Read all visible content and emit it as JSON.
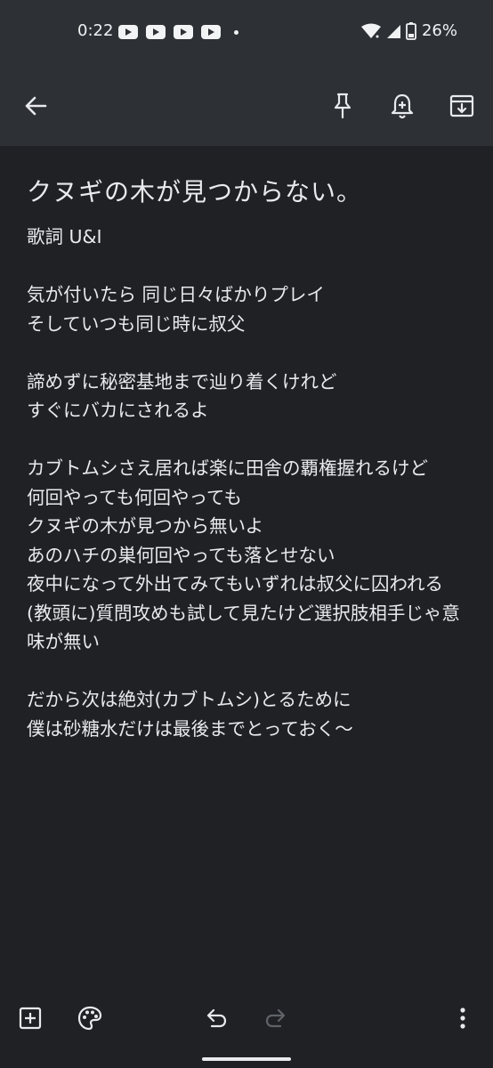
{
  "status_bar": {
    "time": "0:22",
    "battery": "26%",
    "app_icons": [
      "youtube-icon",
      "youtube-icon",
      "youtube-icon",
      "youtube-icon"
    ]
  },
  "toolbar": {
    "icons": [
      "back-arrow-icon",
      "pin-icon",
      "reminder-bell-icon",
      "archive-icon"
    ]
  },
  "note": {
    "title": "クヌギの木が見つからない。",
    "body": "歌詞 U&I\n\n気が付いたら 同じ日々ばかりプレイ\nそしていつも同じ時に叔父\n\n諦めずに秘密基地まで辿り着くけれど\nすぐにバカにされるよ\n\nカブトムシさえ居れば楽に田舎の覇権握れるけど\n何回やっても何回やっても\nクヌギの木が見つから無いよ\nあのハチの巣何回やっても落とせない\n夜中になって外出てみてもいずれは叔父に囚われる\n(教頭に)質問攻めも試して見たけど選択肢相手じゃ意味が無い\n\nだから次は絶対(カブトムシ)とるために\n僕は砂糖水だけは最後までとっておく〜"
  },
  "bottom_bar": {
    "icons": [
      "add-box-icon",
      "palette-icon",
      "undo-icon",
      "redo-icon",
      "more-vert-icon"
    ]
  }
}
